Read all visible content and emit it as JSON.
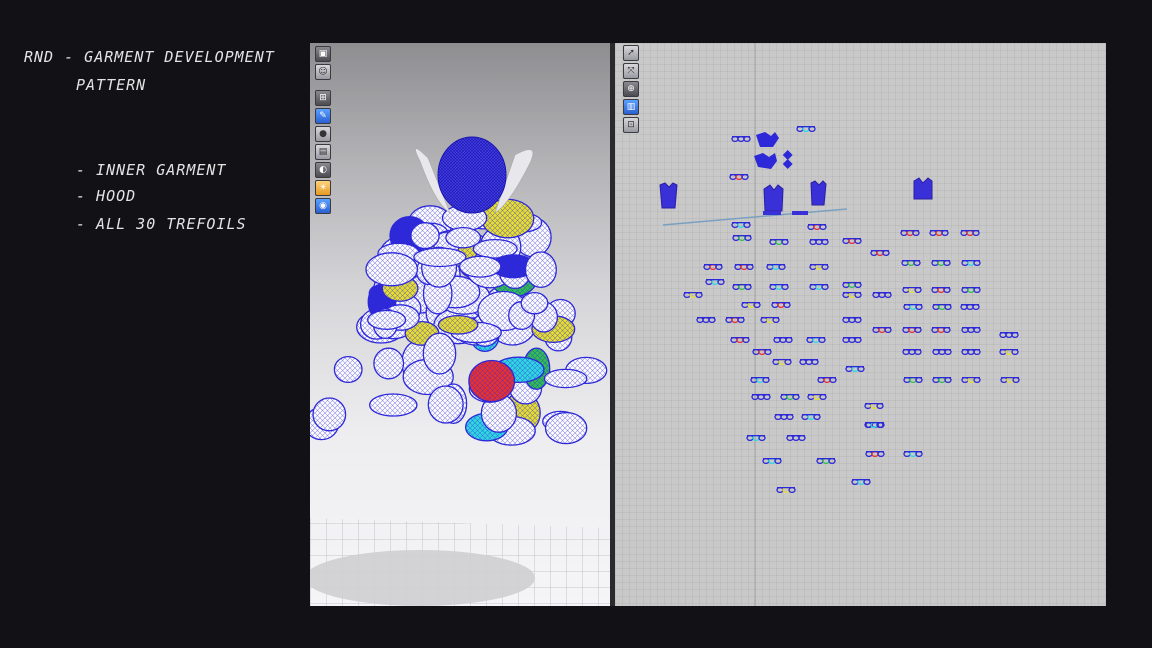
{
  "notes": {
    "line1": "RND - GARMENT DEVELOPMENT",
    "line2": "PATTERN",
    "line3": "- INNER GARMENT",
    "line4": "- HOOD",
    "line5": "- ALL 30 TREFOILS"
  },
  "viewport3d": {
    "toolbar_icons": [
      "render-icon",
      "avatar-icon",
      "arrange-icon",
      "brush-icon",
      "pin-icon",
      "fabric-icon",
      "shade-icon",
      "light-icon",
      "globe-icon"
    ],
    "garment_colors": [
      "#2d28d8",
      "#e83030",
      "#e8e030",
      "#30d8e0",
      "#30c050",
      "#ffffff"
    ]
  },
  "pattern2d": {
    "toolbar_icons": [
      "select-icon",
      "transform-icon",
      "zoom-icon",
      "layer-icon",
      "lock-icon"
    ],
    "piece_colors": [
      "#2d28d8",
      "#e83030",
      "#e8e030",
      "#30d8e0",
      "#30c050"
    ]
  }
}
